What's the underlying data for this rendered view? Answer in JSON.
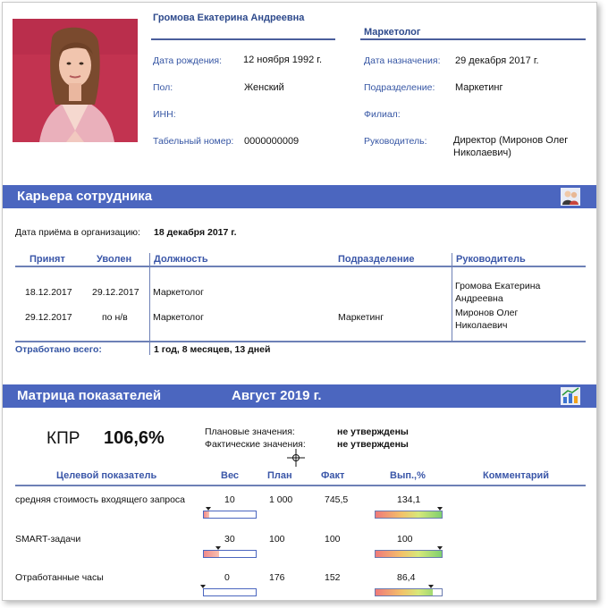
{
  "employee": {
    "name": "Громова Екатерина Андреевна",
    "position": "Маркетолог",
    "birth_label": "Дата рождения:",
    "birth_value": "12 ноября 1992 г.",
    "gender_label": "Пол:",
    "gender_value": "Женский",
    "inn_label": "ИНН:",
    "inn_value": "",
    "tab_label": "Табельный номер:",
    "tab_value": "0000000009",
    "appoint_label": "Дата назначения:",
    "appoint_value": "29 декабря 2017 г.",
    "dept_label": "Подразделение:",
    "dept_value": "Маркетинг",
    "branch_label": "Филиал:",
    "branch_value": "",
    "manager_label": "Руководитель:",
    "manager_value": "Директор (Миронов Олег Николаевич)"
  },
  "career": {
    "title": "Карьера сотрудника",
    "icon": "people-icon",
    "hire_label": "Дата приёма в организацию:",
    "hire_value": "18 декабря 2017 г.",
    "headers": {
      "hired": "Принят",
      "fired": "Уволен",
      "position": "Должность",
      "dept": "Подразделение",
      "manager": "Руководитель"
    },
    "rows": [
      {
        "hired": "18.12.2017",
        "fired": "29.12.2017",
        "position": "Маркетолог",
        "dept": "",
        "manager": "Громова Екатерина Андреевна"
      },
      {
        "hired": "29.12.2017",
        "fired": "по н/в",
        "position": "Маркетолог",
        "dept": "Маркетинг",
        "manager": "Миронов Олег Николаевич"
      }
    ],
    "total_label": "Отработано всего:",
    "total_value": "1 год, 8 месяцев, 13 дней"
  },
  "matrix": {
    "title": "Матрица показателей",
    "period": "Август 2019 г.",
    "icon": "chart-icon",
    "kpr_label": "КПР",
    "kpr_value": "106,6%",
    "plan_label": "Плановые значения:",
    "plan_value": "не утверждены",
    "fact_label": "Фактические значения:",
    "fact_value": "не утверждены",
    "headers": {
      "indicator": "Целевой показатель",
      "weight": "Вес",
      "plan": "План",
      "fact": "Факт",
      "perf": "Вып.,%",
      "comment": "Комментарий"
    },
    "rows": [
      {
        "indicator": "средняя стоимость входящего запроса",
        "weight": "10",
        "plan": "1 000",
        "fact": "745,5",
        "perf": "134,1",
        "weight_level": 0.1,
        "perf_level": 1.0
      },
      {
        "indicator": "SMART-задачи",
        "weight": "30",
        "plan": "100",
        "fact": "100",
        "perf": "100",
        "weight_level": 0.3,
        "perf_level": 1.0
      },
      {
        "indicator": "Отработанные часы",
        "weight": "0",
        "plan": "176",
        "fact": "152",
        "perf": "86,4",
        "weight_level": 0.0,
        "perf_level": 0.864
      }
    ]
  },
  "colors": {
    "accent": "#4b66bf",
    "label": "#3656a4"
  }
}
